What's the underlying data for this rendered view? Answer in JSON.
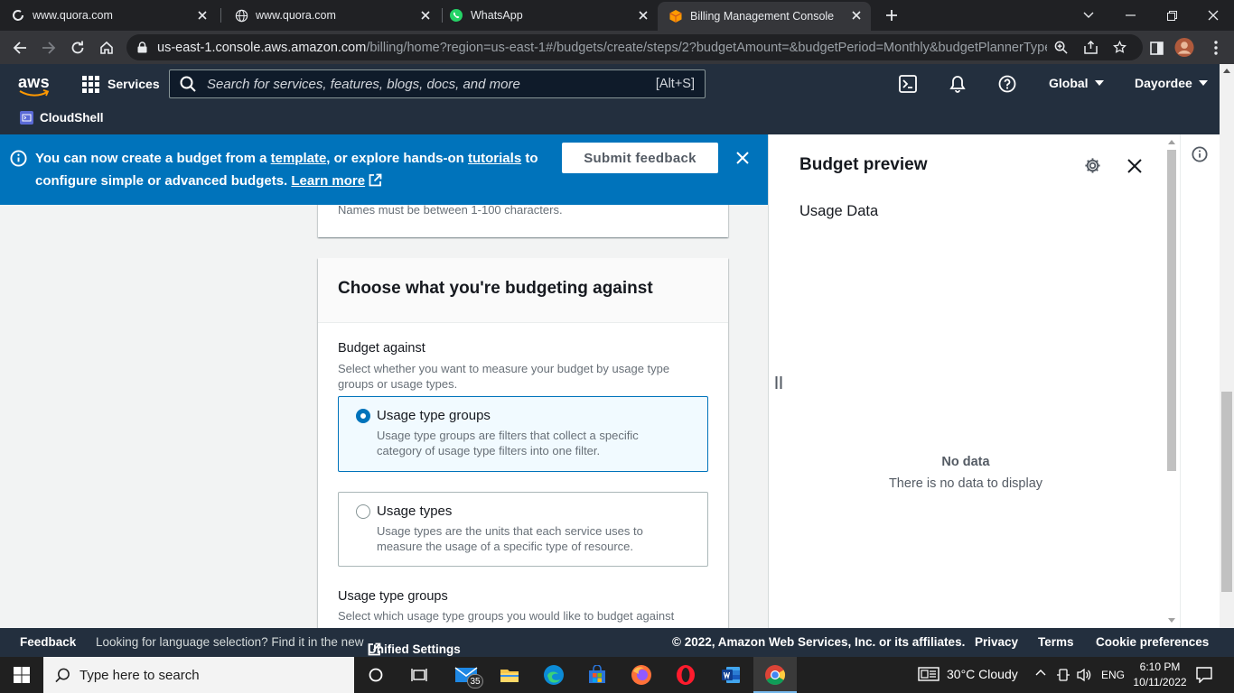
{
  "browser": {
    "tabs": [
      {
        "title": "www.quora.com",
        "favicon": "loading-icon"
      },
      {
        "title": "www.quora.com",
        "favicon": "globe-icon"
      },
      {
        "title": "WhatsApp",
        "favicon": "whatsapp-icon"
      },
      {
        "title": "Billing Management Console",
        "favicon": "aws-icon"
      }
    ],
    "url_host": "us-east-1.console.aws.amazon.com",
    "url_path": "/billing/home?region=us-east-1#/budgets/create/steps/2?budgetAmount=&budgetPeriod=Monthly&budgetPlannerType..."
  },
  "aws": {
    "logo": "aws",
    "services_label": "Services",
    "search_placeholder": "Search for services, features, blogs, docs, and more",
    "search_shortcut": "[Alt+S]",
    "region": "Global",
    "account": "Dayordee",
    "cloudshell": "CloudShell"
  },
  "banner": {
    "text_1": "You can now create a budget from a ",
    "link_template": "template",
    "text_2": ", or explore hands-on ",
    "link_tutorials": "tutorials",
    "text_3": " to configure simple or advanced budgets. ",
    "link_learn": "Learn more",
    "feedback_button": "Submit feedback"
  },
  "form": {
    "name_hint": "Names must be between 1-100 characters.",
    "section_title": "Choose what you're budgeting against",
    "budget_against_label": "Budget against",
    "budget_against_desc": "Select whether you want to measure your budget by usage type groups or usage types.",
    "options": [
      {
        "label": "Usage type groups",
        "desc": "Usage type groups are filters that collect a specific category of usage type filters into one filter.",
        "selected": true
      },
      {
        "label": "Usage types",
        "desc": "Usage types are the units that each service uses to measure the usage of a specific type of resource.",
        "selected": false
      }
    ],
    "groups_label": "Usage type groups",
    "groups_desc": "Select which usage type groups you would like to budget against"
  },
  "preview": {
    "title": "Budget preview",
    "subtitle": "Usage Data",
    "empty_title": "No data",
    "empty_desc": "There is no data to display"
  },
  "footer": {
    "feedback": "Feedback",
    "lang_text": "Looking for language selection? Find it in the new",
    "unified": "Unified Settings",
    "copyright": "© 2022, Amazon Web Services, Inc. or its affiliates.",
    "privacy": "Privacy",
    "terms": "Terms",
    "cookies": "Cookie preferences"
  },
  "taskbar": {
    "search_placeholder": "Type here to search",
    "mail_badge": "35",
    "weather": "30°C  Cloudy",
    "lang": "ENG",
    "time": "6:10 PM",
    "date": "10/11/2022"
  },
  "colors": {
    "aws_nav": "#232f3e",
    "banner": "#0073bb",
    "accent": "#0073bb",
    "aws_orange": "#ff9900"
  }
}
